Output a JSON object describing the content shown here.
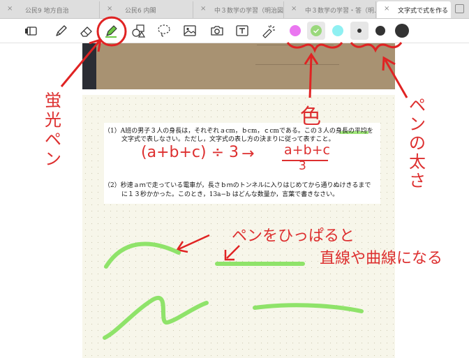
{
  "tabs": [
    {
      "label": "公民9 地方自治",
      "active": false
    },
    {
      "label": "公民6 内閣",
      "active": false
    },
    {
      "label": "中３数学の学習（明治図…",
      "active": false
    },
    {
      "label": "中３数学の学習・答（明…",
      "active": false
    },
    {
      "label": "文字式で式を作る",
      "active": true
    }
  ],
  "tab_close_glyph": "×",
  "toolbar": {
    "tools": [
      "sidebar-toggle-icon",
      "pen-icon",
      "eraser-icon",
      "highlighter-icon",
      "shapes-icon",
      "lasso-icon",
      "image-icon",
      "camera-icon",
      "text-box-icon",
      "laser-pointer-icon"
    ],
    "colors": [
      "#ea76f0",
      "#9ad87c",
      "#8ff0f2"
    ],
    "selected_color": "#9ad87c",
    "sizes": [
      "small",
      "medium",
      "large"
    ],
    "selected_size": "small"
  },
  "problems": {
    "p1_line1": "（1）A班の男子３人の身長は，それぞれａcm，ｂcm，ｃcmである。この３人の身長の平均を",
    "p1_line2": "文字式で表しなさい。ただし，文字式の表し方の決まりに従って表すこと。",
    "p2_line1": "（2）秒速ａｍで走っている電車が，長さｂｍのトンネルに入りはじめてから通りぬけきるまで",
    "p2_line2": "に１３秒かかった。このとき，13a−b はどんな数量か，言葉で書きなさい。"
  },
  "annotations": {
    "highlighter_label": "蛍光ペン",
    "color_label": "色",
    "size_label": "ペンの太さ",
    "drag_label_1": "ペンをひっぱると",
    "drag_label_2": "直線や曲線になる",
    "equation_left": "(a+b+c) ÷ 3",
    "arrow_glyph": "→",
    "equation_num": "a+b+c",
    "equation_den": "3"
  },
  "accent_colors": {
    "annotation": "#dd2f2f",
    "highlighter_stroke": "#8fe36a"
  }
}
